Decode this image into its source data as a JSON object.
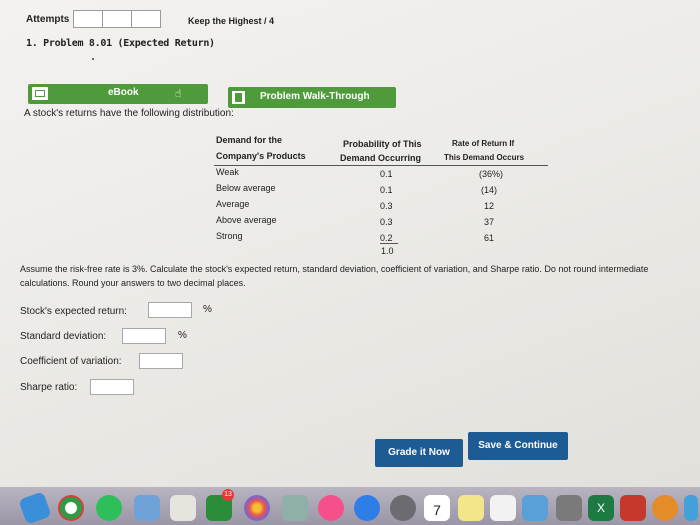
{
  "header": {
    "attempts_label": "Attempts",
    "keep_highest": "Keep the Highest / 4",
    "problem_title": "1. Problem 8.01 (Expected Return)"
  },
  "buttons": {
    "ebook": "eBook",
    "walkthrough": "Problem Walk-Through",
    "grade": "Grade it Now",
    "save": "Save & Continue"
  },
  "intro": "A stock's returns have the following distribution:",
  "table": {
    "headers": {
      "demand_line1": "Demand for the",
      "demand_line2": "Company's Products",
      "prob_line1": "Probability of This",
      "prob_line2": "Demand Occurring",
      "rate_line1": "Rate of Return If",
      "rate_line2": "This Demand Occurs"
    },
    "rows": [
      {
        "demand": "Weak",
        "prob": "0.1",
        "rate": "(36%)"
      },
      {
        "demand": "Below average",
        "prob": "0.1",
        "rate": "(14)"
      },
      {
        "demand": "Average",
        "prob": "0.3",
        "rate": "12"
      },
      {
        "demand": "Above average",
        "prob": "0.3",
        "rate": "37"
      },
      {
        "demand": "Strong",
        "prob": "0.2",
        "rate": "61"
      }
    ],
    "total": "1.0"
  },
  "assume_text": "Assume the risk-free rate is 3%. Calculate the stock's expected return, standard deviation, coefficient of variation, and Sharpe ratio. Do not round intermediate calculations. Round your answers to two decimal places.",
  "fields": {
    "expected_return": {
      "label": "Stock's expected return:",
      "value": "",
      "unit": "%"
    },
    "std_dev": {
      "label": "Standard deviation:",
      "value": "",
      "unit": "%"
    },
    "coeff_var": {
      "label": "Coefficient of variation:",
      "value": ""
    },
    "sharpe": {
      "label": "Sharpe ratio:",
      "value": ""
    }
  },
  "dock": {
    "badge_count": "13",
    "calendar_day": "7"
  },
  "colors": {
    "green_button": "#4f9a3a",
    "blue_button": "#1c5b94"
  }
}
